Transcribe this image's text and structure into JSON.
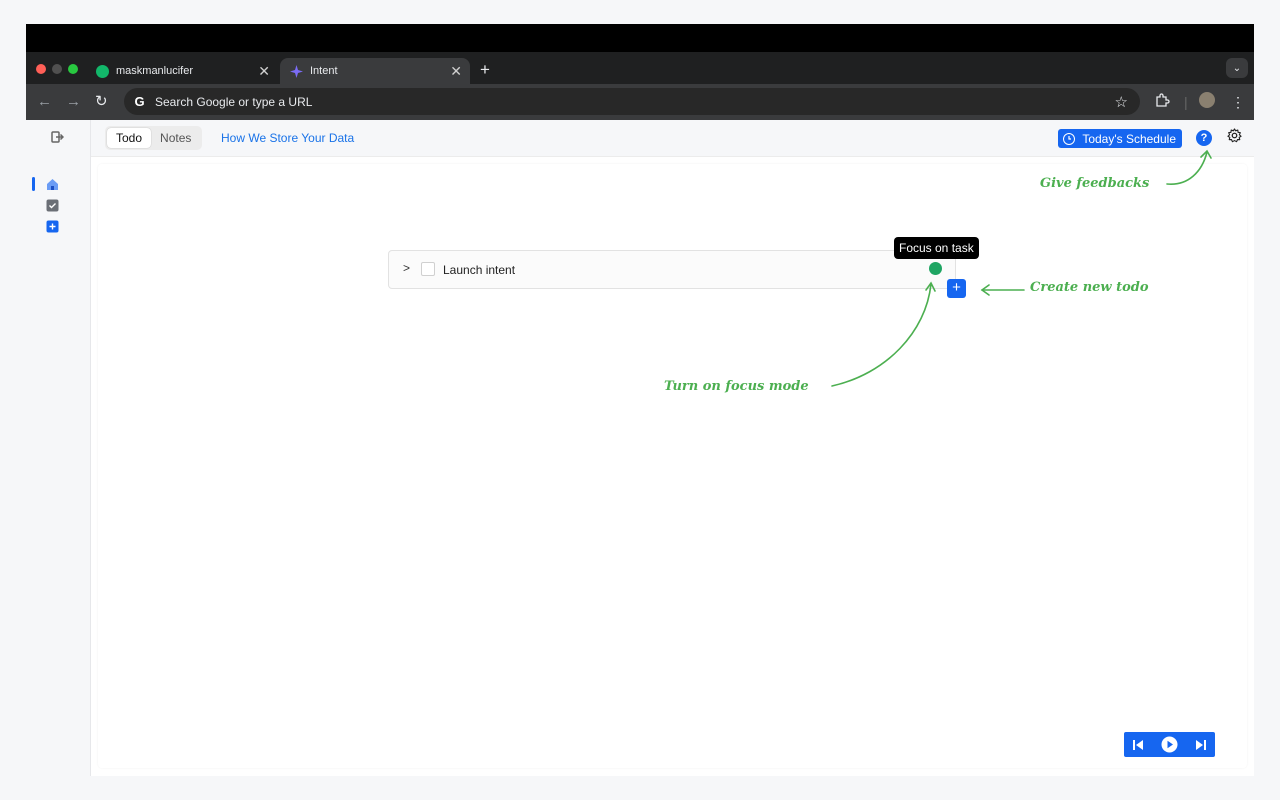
{
  "browser": {
    "tabs": [
      {
        "title": "maskmanlucifer",
        "active": false
      },
      {
        "title": "Intent",
        "active": true
      }
    ],
    "omnibox": {
      "placeholder": "Search Google or type a URL",
      "logo": "G"
    }
  },
  "app": {
    "header": {
      "segments": [
        "Todo",
        "Notes"
      ],
      "selected_segment": "Todo",
      "data_link": "How We Store Your Data",
      "schedule_button": "Today's Schedule",
      "help_label": "?"
    },
    "todo": {
      "items": [
        {
          "text": "Launch intent",
          "checked": false
        }
      ],
      "tooltip": "Focus on task",
      "add_label": "+"
    },
    "annotations": {
      "feedback": "Give feedbacks",
      "create": "Create new todo",
      "focus": "Turn on focus mode"
    }
  },
  "colors": {
    "accent": "#1666f0",
    "focus_dot": "#1fa563",
    "annotation": "#4caf50"
  }
}
